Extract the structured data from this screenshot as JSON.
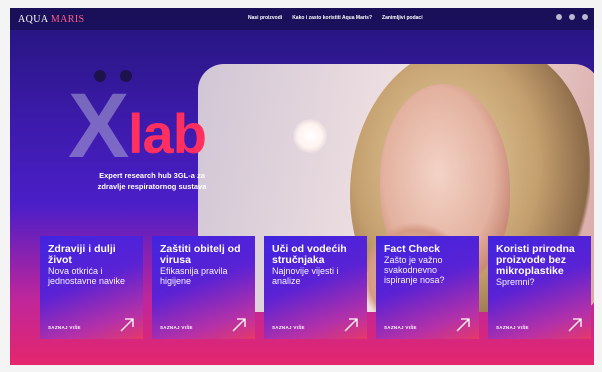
{
  "header": {
    "brand_part1": "AQUA",
    "brand_part2": "MARIS",
    "nav": [
      "Nasi proizvodi",
      "Kako i zasto koristiti Aqua Maris?",
      "Zanimljivi podaci"
    ],
    "icons": [
      "search-icon",
      "user-icon",
      "menu-icon"
    ]
  },
  "hero": {
    "logo_x": "X",
    "logo_lab": "lab",
    "tagline": "Expert research hub 3GL-a za zdravlje respiratornog sustava"
  },
  "cards": [
    {
      "title": "Zdraviji i dulji život",
      "subtitle": "Nova otkrića i jednostavne navike",
      "more": "SAZNAJ VIŠE"
    },
    {
      "title": "Zaštiti obitelj od virusa",
      "subtitle": "Efikasnija pravila higijene",
      "more": "SAZNAJ VIŠE"
    },
    {
      "title": "Uči od vodećih stručnjaka",
      "subtitle": "Najnovije vijesti i analize",
      "more": "SAZNAJ VIŠE"
    },
    {
      "title": "Fact Check",
      "subtitle": "Zašto je važno svakodnevno ispiranje nosa?",
      "more": "SAZNAJ VIŠE"
    },
    {
      "title": "Koristi prirodna proizvode bez mikroplastike",
      "subtitle": "Spremni?",
      "more": "SAZNAJ VIŠE"
    }
  ],
  "colors": {
    "accent": "#ff2f5f",
    "deep": "#23157a",
    "card_top": "#4024e0"
  }
}
